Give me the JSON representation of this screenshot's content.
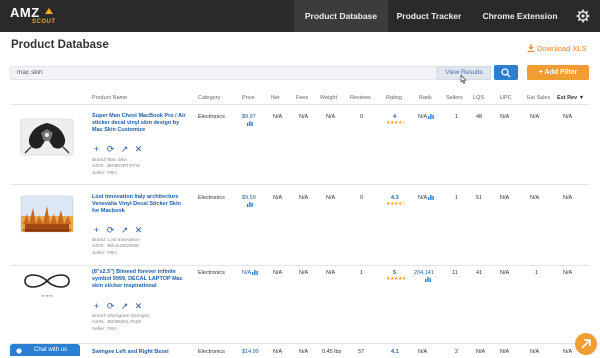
{
  "brand": {
    "name": "AMZ",
    "sub": "SCOUT",
    "accent": "#f5a623"
  },
  "nav": {
    "tabs": [
      {
        "label": "Product Database",
        "active": true
      },
      {
        "label": "Product Tracker",
        "active": false
      },
      {
        "label": "Chrome Extension",
        "active": false
      }
    ],
    "settings_icon": "gear-icon"
  },
  "header": {
    "title": "Product Database",
    "download_label": "Download XLS"
  },
  "search": {
    "value": "mac skin",
    "view_results_label": "View Results",
    "add_filter_label": "+ Add Filter"
  },
  "table": {
    "columns": {
      "name": "Product Name",
      "category": "Category",
      "price": "Price",
      "fees": "Fees",
      "net": "Net",
      "weight": "Weight",
      "reviews": "Reviews",
      "rating": "Rating",
      "rank": "Rank",
      "sellers": "Sellers",
      "lqs": "LQS",
      "upc": "UPC",
      "est_sales": "Est Sales",
      "est_rev": "Est Rev"
    },
    "sort_indicator": "▼",
    "rows": [
      {
        "name": "Super Man Chest MacBook Pro / Air sticker decal vinyl skin design by Mac Skin Customize",
        "category": "Electronics",
        "price": "$9.97",
        "fees": "N/A",
        "net": "N/A",
        "weight": "N/A",
        "reviews": "0",
        "rating": "4",
        "stars": "★★★★☆",
        "rank": "N/A",
        "sellers": "1",
        "lqs": "48",
        "upc": "N/A",
        "est_sales": "N/A",
        "est_rev": "N/A",
        "brand": "Mac Skin",
        "asin": "B00BORTVYW",
        "seller": "FBA"
      },
      {
        "name": "Lost Innovation Italy architecture Venevalia Vinyl Decal Sticker Skin for Macbook",
        "category": "Electronics",
        "price": "$9.59",
        "fees": "N/A",
        "net": "N/A",
        "weight": "N/A",
        "reviews": "0",
        "rating": "4.3",
        "stars": "★★★★☆",
        "rank": "N/A",
        "sellers": "1",
        "lqs": "51",
        "upc": "N/A",
        "est_sales": "N/A",
        "est_rev": "N/A",
        "brand": "Lost Innovation",
        "asin": "B0ULDCDO0E",
        "seller": "FBA"
      },
      {
        "name": "(8\"x2.5\") Bimeed forever infinite symbol 9999, DECAL LAPTOP Mac skin sticker inspirational",
        "category": "Electronics",
        "price": "N/A",
        "fees": "N/A",
        "net": "N/A",
        "weight": "N/A",
        "reviews": "1",
        "rating": "5",
        "stars": "★★★★★",
        "rank": "204,141",
        "sellers": "11",
        "lqs": "41",
        "upc": "N/A",
        "est_sales": "1",
        "est_rev": "N/A",
        "brand": "Shengram Sensgim",
        "asin": "B00BMGL7NZ0",
        "seller": "FBA"
      },
      {
        "name": "Swingee Left and Right Bezel",
        "category": "Electronics",
        "price": "$14.99",
        "fees": "N/A",
        "net": "N/A",
        "weight": "0.45 lbs",
        "reviews": "57",
        "rating": "4.1",
        "stars": "",
        "rank": "N/A",
        "sellers": "2",
        "lqs": "N/A",
        "upc": "N/A",
        "est_sales": "N/A",
        "est_rev": "N/A"
      }
    ],
    "meta_labels": {
      "brand": "Brand:",
      "asin": "ASIN:",
      "seller": "Seller:"
    }
  },
  "chat": {
    "label": "Chat with us"
  },
  "colors": {
    "nav_bg": "#2a2a2a",
    "primary": "#2a7fd1",
    "orange": "#f39c33",
    "link": "#1f5ea8"
  }
}
